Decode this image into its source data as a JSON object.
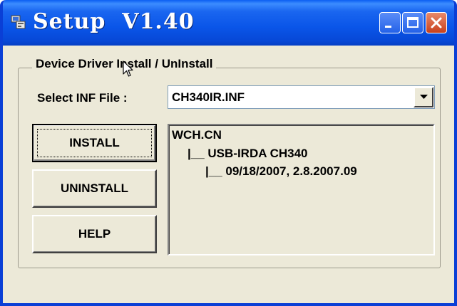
{
  "window": {
    "title": "Setup  V1.40",
    "controls": {
      "minimize": "minimize",
      "maximize": "maximize",
      "close": "close"
    }
  },
  "group": {
    "label": "Device Driver Install / UnInstall"
  },
  "inf_select": {
    "label": "Select INF File :",
    "value": "CH340IR.INF"
  },
  "buttons": {
    "install": "INSTALL",
    "uninstall": "UNINSTALL",
    "help": "HELP"
  },
  "driver_tree": {
    "vendor": "WCH.CN",
    "device": "|__ USB-IRDA CH340",
    "version": "|__ 09/18/2007, 2.8.2007.09"
  },
  "colors": {
    "titlebar": "#0a55e8",
    "window_bg": "#ece9d8",
    "close_button": "#c8401c"
  },
  "icons": [
    "app-icon",
    "minimize-icon",
    "maximize-icon",
    "close-icon",
    "dropdown-arrow-icon",
    "mouse-cursor-icon"
  ]
}
